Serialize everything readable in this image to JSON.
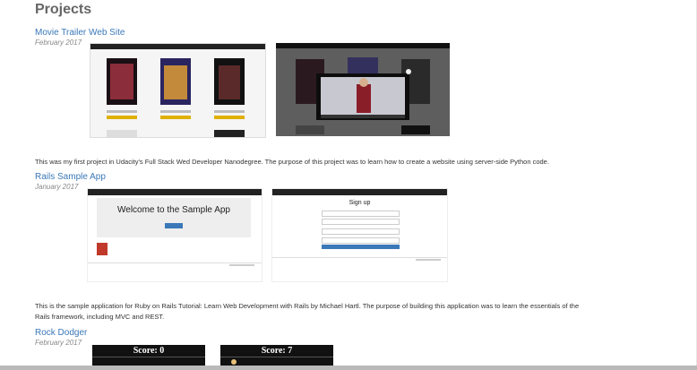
{
  "page": {
    "title": "Projects"
  },
  "projects": [
    {
      "title": "Movie Trailer Web Site",
      "date": "February 2017",
      "description": "This was my first project in Udacity's Full Stack Wed Developer Nanodegree. The purpose of this project was to learn how to create a website using server-side Python code."
    },
    {
      "title": "Rails Sample App",
      "date": "January 2017",
      "description_line1": "This is the sample application for Ruby on Rails Tutorial: Learn Web Development with Rails by Michael Hartl. The purpose of building this application was to learn the essentials of the",
      "description_line2": "Rails framework, including MVC and REST.",
      "welcome_text": "Welcome to the Sample App",
      "signup_text": "Sign up"
    },
    {
      "title": "Rock Dodger",
      "date": "February 2017",
      "score1": "Score: 0",
      "score2": "Score: 7"
    }
  ]
}
